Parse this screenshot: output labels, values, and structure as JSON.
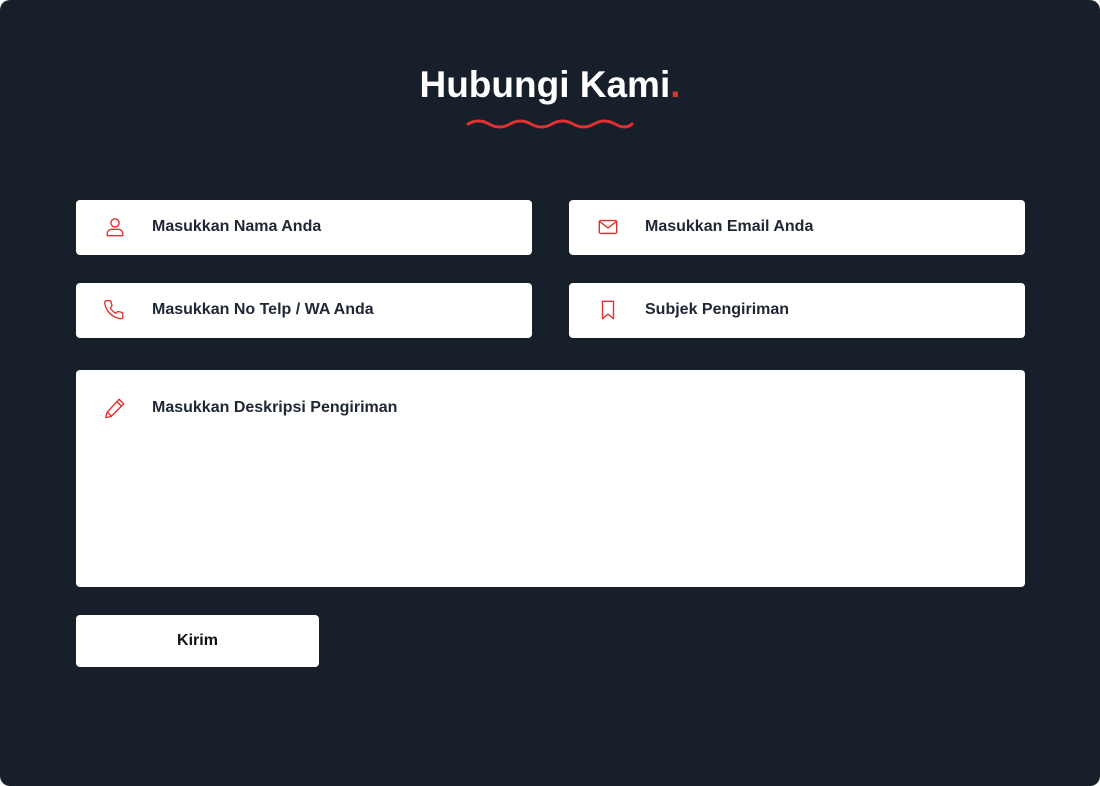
{
  "contact": {
    "title": "Hubungi Kami",
    "title_dot": ".",
    "accent_color": "#e0302f",
    "background_color": "#17202a"
  },
  "form": {
    "name_placeholder": "Masukkan Nama Anda",
    "email_placeholder": "Masukkan Email Anda",
    "phone_placeholder": "Masukkan No Telp / WA Anda",
    "subject_placeholder": "Subjek Pengiriman",
    "description_placeholder": "Masukkan Deskripsi Pengiriman",
    "submit_label": "Kirim"
  },
  "icons": {
    "name": "user-icon",
    "email": "envelope-icon",
    "phone": "phone-icon",
    "subject": "bookmark-icon",
    "description": "pencil-icon"
  }
}
